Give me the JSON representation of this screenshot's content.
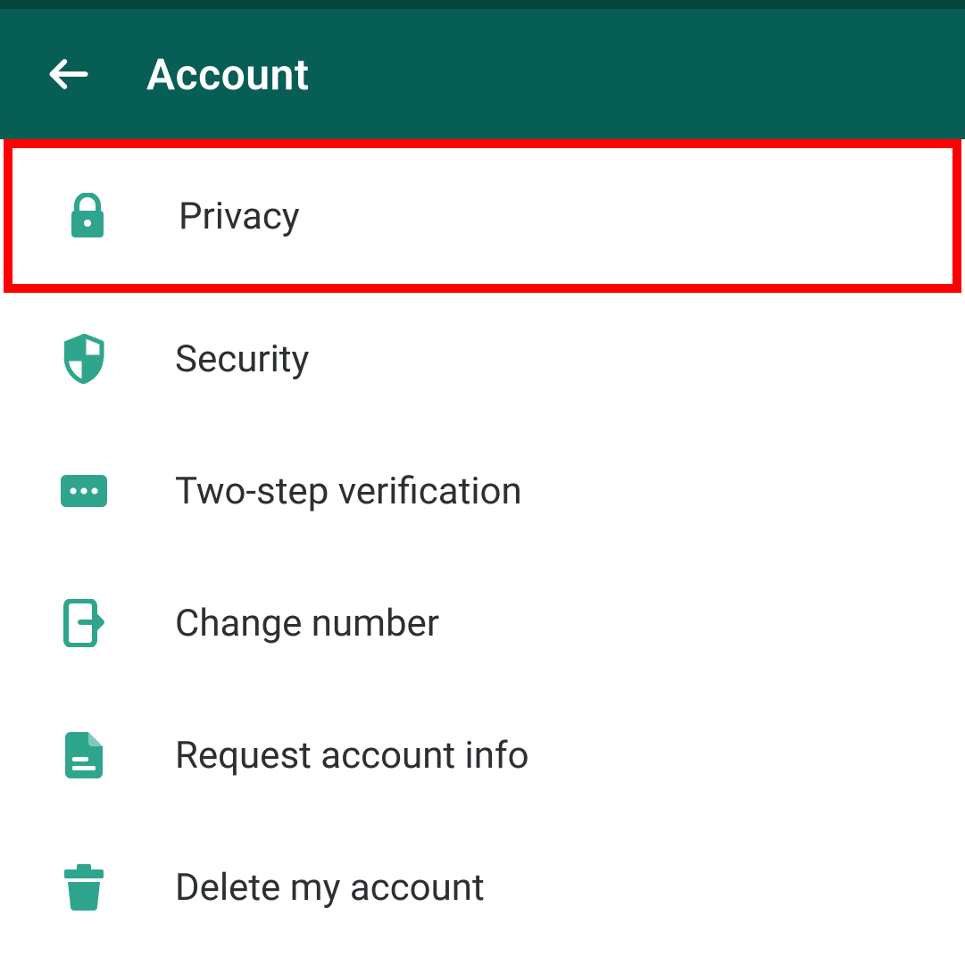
{
  "header": {
    "title": "Account"
  },
  "menu": {
    "items": [
      {
        "label": "Privacy",
        "highlighted": true
      },
      {
        "label": "Security",
        "highlighted": false
      },
      {
        "label": "Two-step verification",
        "highlighted": false
      },
      {
        "label": "Change number",
        "highlighted": false
      },
      {
        "label": "Request account info",
        "highlighted": false
      },
      {
        "label": "Delete my account",
        "highlighted": false
      }
    ]
  },
  "colors": {
    "primary": "#075e54",
    "accent": "#2fa58e",
    "highlight": "#ff0000"
  }
}
